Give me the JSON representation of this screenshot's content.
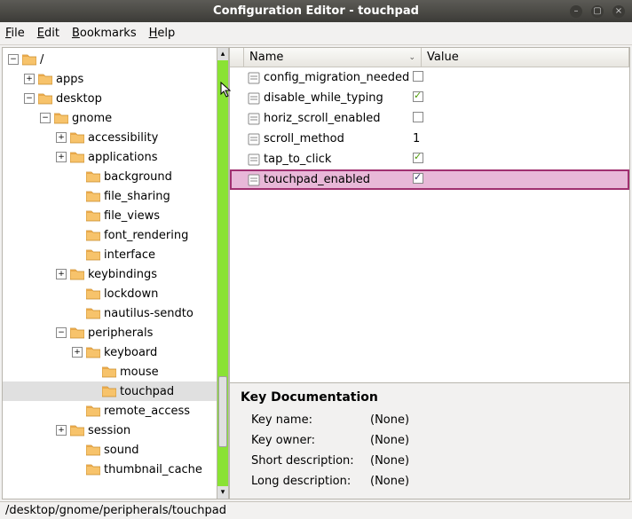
{
  "window": {
    "title": "Configuration Editor - touchpad"
  },
  "menu": {
    "file": "File",
    "edit": "Edit",
    "bookmarks": "Bookmarks",
    "help": "Help"
  },
  "tree": {
    "root": "/",
    "items": [
      {
        "label": "apps",
        "depth": 1,
        "exp": "+"
      },
      {
        "label": "desktop",
        "depth": 1,
        "exp": "-"
      },
      {
        "label": "gnome",
        "depth": 2,
        "exp": "-"
      },
      {
        "label": "accessibility",
        "depth": 3,
        "exp": "+"
      },
      {
        "label": "applications",
        "depth": 3,
        "exp": "+"
      },
      {
        "label": "background",
        "depth": 4,
        "exp": ""
      },
      {
        "label": "file_sharing",
        "depth": 4,
        "exp": ""
      },
      {
        "label": "file_views",
        "depth": 4,
        "exp": ""
      },
      {
        "label": "font_rendering",
        "depth": 4,
        "exp": ""
      },
      {
        "label": "interface",
        "depth": 4,
        "exp": ""
      },
      {
        "label": "keybindings",
        "depth": 3,
        "exp": "+"
      },
      {
        "label": "lockdown",
        "depth": 4,
        "exp": ""
      },
      {
        "label": "nautilus-sendto",
        "depth": 4,
        "exp": ""
      },
      {
        "label": "peripherals",
        "depth": 3,
        "exp": "-"
      },
      {
        "label": "keyboard",
        "depth": 4,
        "exp": "+"
      },
      {
        "label": "mouse",
        "depth": 5,
        "exp": ""
      },
      {
        "label": "touchpad",
        "depth": 5,
        "exp": "",
        "selected": true
      },
      {
        "label": "remote_access",
        "depth": 4,
        "exp": ""
      },
      {
        "label": "session",
        "depth": 3,
        "exp": "+"
      },
      {
        "label": "sound",
        "depth": 4,
        "exp": ""
      },
      {
        "label": "thumbnail_cache",
        "depth": 4,
        "exp": ""
      }
    ]
  },
  "table": {
    "head_name": "Name",
    "head_value": "Value",
    "rows": [
      {
        "name": "config_migration_needed",
        "type": "bool",
        "val": false
      },
      {
        "name": "disable_while_typing",
        "type": "bool",
        "val": true
      },
      {
        "name": "horiz_scroll_enabled",
        "type": "bool",
        "val": false
      },
      {
        "name": "scroll_method",
        "type": "int",
        "val": "1"
      },
      {
        "name": "tap_to_click",
        "type": "bool",
        "val": true
      },
      {
        "name": "touchpad_enabled",
        "type": "bool",
        "val": true,
        "selected": true
      }
    ]
  },
  "doc": {
    "title": "Key Documentation",
    "key_name_label": "Key name:",
    "key_name_val": "(None)",
    "key_owner_label": "Key owner:",
    "key_owner_val": "(None)",
    "short_label": "Short description:",
    "short_val": "(None)",
    "long_label": "Long description:",
    "long_val": "(None)"
  },
  "status": {
    "path": "/desktop/gnome/peripherals/touchpad"
  }
}
